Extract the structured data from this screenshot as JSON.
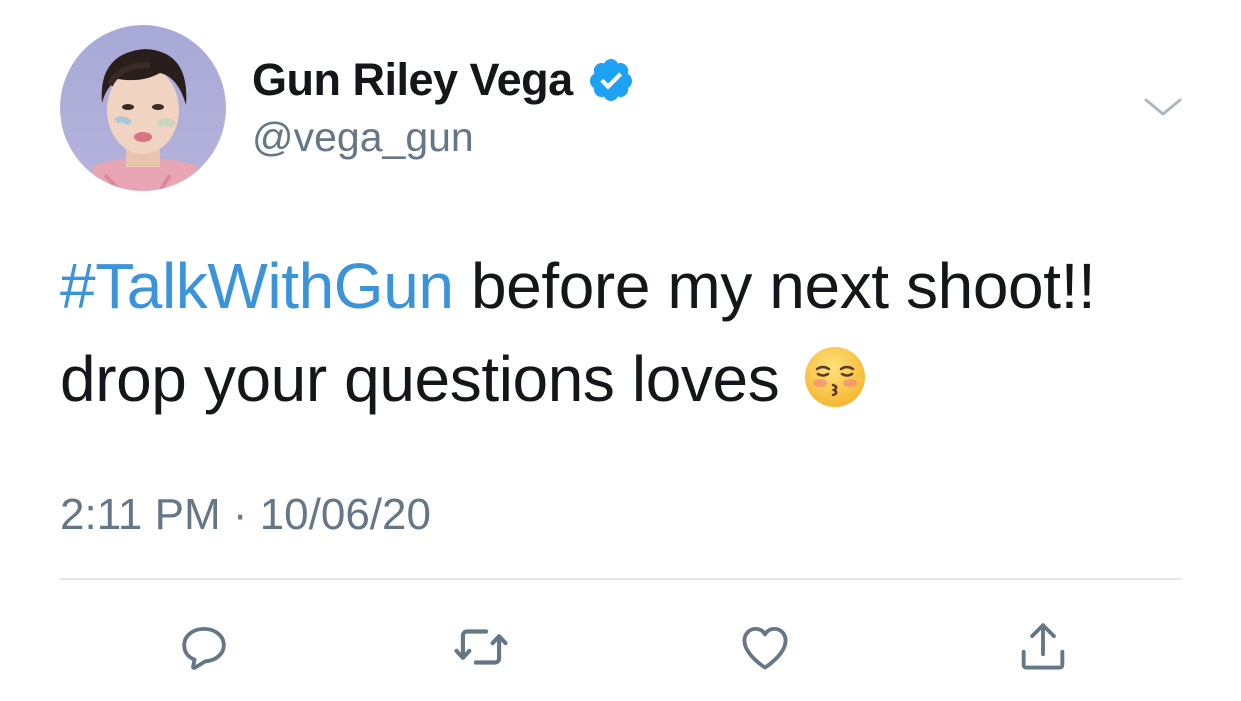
{
  "user": {
    "display_name": "Gun Riley Vega",
    "handle": "@vega_gun",
    "verified": true,
    "avatar_icon": "profile-photo"
  },
  "tweet": {
    "hashtag": "#TalkWithGun",
    "line1_rest": " before my next shoot!!",
    "line2": "drop your questions loves",
    "emoji": "kissing-face-with-closed-eyes",
    "timestamp": "2:11 PM · 10/06/20"
  },
  "actions": [
    {
      "name": "reply",
      "icon": "reply-icon"
    },
    {
      "name": "retweet",
      "icon": "retweet-icon"
    },
    {
      "name": "like",
      "icon": "heart-icon"
    },
    {
      "name": "share",
      "icon": "share-icon"
    }
  ],
  "colors": {
    "link": "#3b94d9",
    "text": "#14171a",
    "secondary": "#657786",
    "verified": "#1da1f2",
    "divider": "#e1e8ed"
  }
}
